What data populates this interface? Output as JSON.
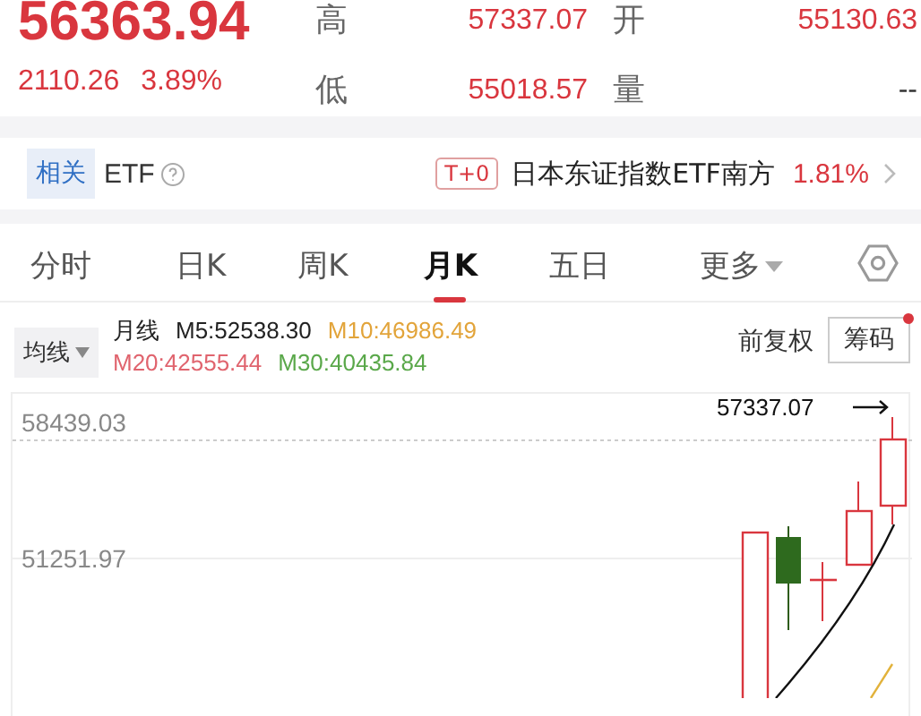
{
  "quote": {
    "price": "56363.94",
    "change": "2110.26",
    "change_pct": "3.89%",
    "stats": [
      {
        "label": "高",
        "value": "57337.07"
      },
      {
        "label": "开",
        "value": "55130.63"
      },
      {
        "label": "低",
        "value": "55018.57"
      },
      {
        "label": "量",
        "value": "--"
      }
    ]
  },
  "etf": {
    "tag": "相关",
    "label": "ETF",
    "badge": "T+0",
    "name": "日本东证指数ETF南方",
    "change": "1.81%"
  },
  "tabs": [
    {
      "label": "分时",
      "selected": false,
      "kind": "tab"
    },
    {
      "label": "日K",
      "selected": false,
      "kind": "tab"
    },
    {
      "label": "周K",
      "selected": false,
      "kind": "tab"
    },
    {
      "label": "月K",
      "selected": true,
      "kind": "tab"
    },
    {
      "label": "五日",
      "selected": false,
      "kind": "tab"
    },
    {
      "label": "更多",
      "selected": false,
      "kind": "menu"
    }
  ],
  "ma": {
    "selector": "均线",
    "title": "月线",
    "adjust": "前复权",
    "chips": "筹码",
    "chips_notice": true,
    "lines": [
      {
        "label": "M5:52538.30",
        "color": "#222222"
      },
      {
        "label": "M10:46986.49",
        "color": "#e2a43a"
      },
      {
        "label": "M20:42555.44",
        "color": "#e0646e"
      },
      {
        "label": "M30:40435.84",
        "color": "#5aa84a"
      }
    ]
  },
  "chart": {
    "y_labels": [
      "58439.03",
      "51251.97"
    ],
    "high_marker": "57337.07"
  }
}
